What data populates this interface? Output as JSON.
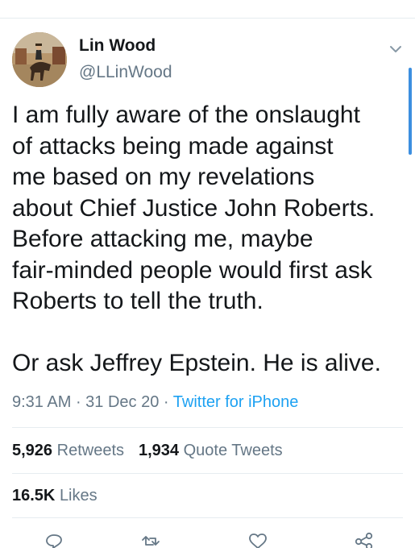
{
  "user": {
    "name": "Lin Wood",
    "handle": "@LLinWood"
  },
  "tweet": {
    "lines_para1": [
      "I am fully aware of the onslaught",
      "of attacks being made against",
      "me based on my revelations",
      "about Chief Justice John Roberts.",
      "Before attacking me, maybe",
      "fair-minded people would first ask",
      "Roberts to tell the truth."
    ],
    "line_para2": "Or ask Jeffrey Epstein. He is alive."
  },
  "meta": {
    "time": "9:31 AM",
    "sep1": " · ",
    "date": "31 Dec 20",
    "sep2": " · ",
    "source": "Twitter for iPhone"
  },
  "stats": {
    "retweets_count": "5,926",
    "retweets_label": "Retweets",
    "quotes_count": "1,934",
    "quotes_label": "Quote Tweets",
    "likes_count": "16.5K",
    "likes_label": "Likes"
  },
  "icons": {
    "reply": "reply-icon",
    "retweet": "retweet-icon",
    "like": "heart-icon",
    "share": "share-icon",
    "more": "chevron-down-icon"
  },
  "colors": {
    "link": "#1da1f2",
    "muted": "#657786",
    "text": "#14171a",
    "divider": "#e6ecf0"
  }
}
